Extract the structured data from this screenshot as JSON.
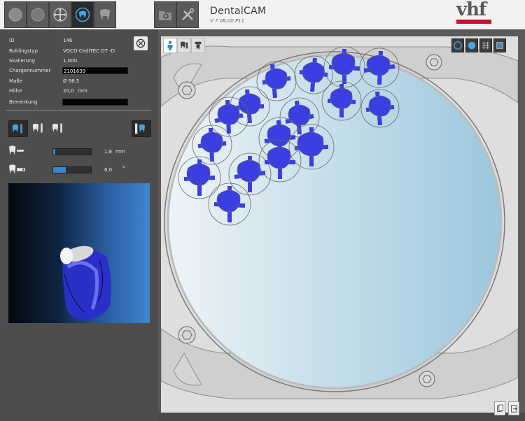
{
  "app": {
    "name": "DentalCAM",
    "version": "V 7.08.00.P11",
    "logo": "vhf",
    "brand_color": "#c8102e",
    "accent_color": "#3a86c8"
  },
  "toolbar": {
    "tabs": [
      {
        "icon": "circle-icon"
      },
      {
        "icon": "blank-circle-icon"
      },
      {
        "icon": "move-icon"
      },
      {
        "icon": "tooth-disc-icon",
        "active": true
      },
      {
        "icon": "tooth-icon"
      }
    ],
    "tools": [
      {
        "icon": "folder-gear-icon"
      },
      {
        "icon": "tools-icon"
      }
    ]
  },
  "properties": {
    "id_label": "ID",
    "id_value": "146",
    "blank_type_label": "Rohlingstyp",
    "blank_type_value": "VOCO CediTEC DT -D",
    "scaling_label": "Skalierung",
    "scaling_value": "1,000",
    "batch_label": "Chargennummer",
    "batch_value": "2101639",
    "dimensions_label": "Maße",
    "dimensions_value": "Ø 98,5",
    "height_label": "Höhe",
    "height_value": "20,0",
    "height_unit": "mm",
    "remark_label": "Bemerkung",
    "remark_value": ""
  },
  "parameters": {
    "distance_value": "1,6",
    "distance_unit": "mm",
    "distance_level": 0.05,
    "angle_value": "6,0",
    "angle_unit": "°",
    "angle_level": 0.33
  },
  "view_modes": [
    {
      "icon": "circle-outline-icon"
    },
    {
      "icon": "filled-circle-icon"
    },
    {
      "icon": "grid-icon"
    },
    {
      "icon": "frame-icon"
    }
  ],
  "bottom_buttons": [
    {
      "icon": "copy-icon"
    },
    {
      "icon": "export-icon"
    }
  ]
}
